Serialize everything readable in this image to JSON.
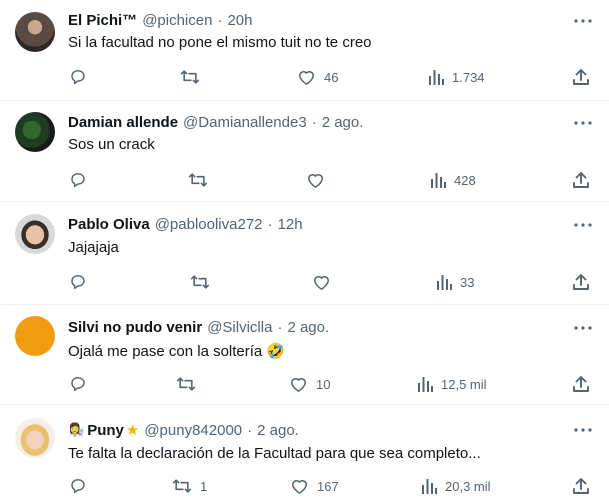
{
  "replies": [
    {
      "name": "El Pichi™",
      "handle": "@pichicen",
      "time": "20h",
      "text": "Si la facultad no pone el mismo tuit no te creo",
      "reply_count": "",
      "retweet_count": "",
      "like_count": "46",
      "views": "1.734",
      "avatar_icon": "user-photo-icon"
    },
    {
      "name": "Damian allende",
      "handle": "@Damianallende3",
      "time": "2 ago.",
      "text": "Sos un crack",
      "reply_count": "",
      "retweet_count": "",
      "like_count": "",
      "views": "428",
      "avatar_icon": "user-photo-icon"
    },
    {
      "name": "Pablo Oliva",
      "handle": "@pablooliva272",
      "time": "12h",
      "text": "Jajajaja",
      "reply_count": "",
      "retweet_count": "",
      "like_count": "",
      "views": "33",
      "avatar_icon": "user-photo-icon"
    },
    {
      "name": "Silvi no pudo venir",
      "handle": "@Silviclla",
      "time": "2 ago.",
      "text": "Ojalá me pase con la soltería 🤣",
      "reply_count": "",
      "retweet_count": "",
      "like_count": "10",
      "views": "12,5 mil",
      "avatar_icon": "orange-circle-avatar"
    },
    {
      "name": "Puny",
      "name_emoji": "👩‍🔬",
      "name_badge": "★",
      "handle": "@puny842000",
      "time": "2 ago.",
      "text": "Te falta la declaración de la Facultad para que sea completo...",
      "reply_count": "",
      "retweet_count": "1",
      "like_count": "167",
      "views": "20,3 mil",
      "avatar_icon": "user-photo-icon"
    }
  ],
  "separator": "·",
  "colors": {
    "text_primary": "#0f1419",
    "text_secondary": "#536471",
    "divider": "#eff3f4",
    "silvi_avatar": "#f29c11",
    "badge_star": "#f4b400"
  }
}
